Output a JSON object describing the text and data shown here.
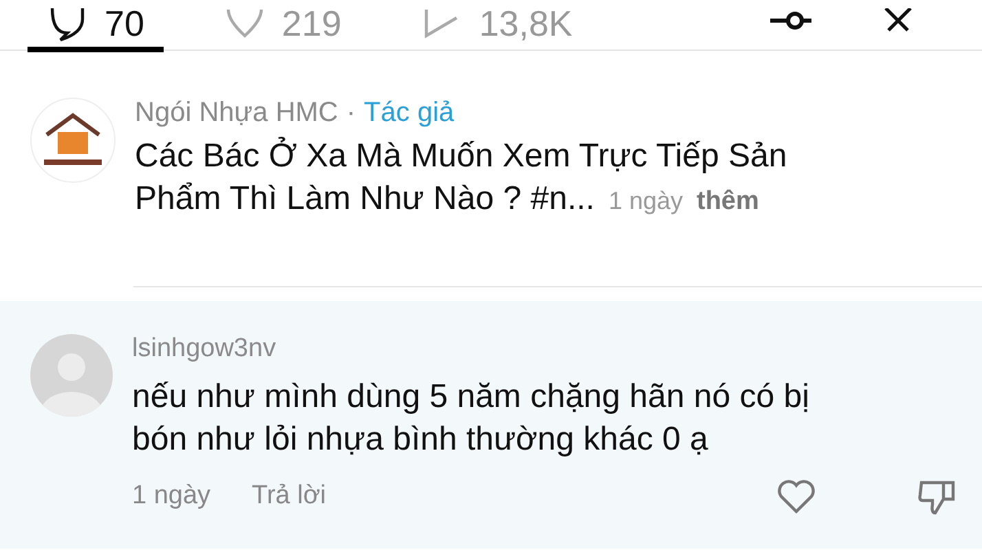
{
  "tabs": [
    {
      "kind": "comments",
      "label": "70",
      "selected": true
    },
    {
      "kind": "likes",
      "label": "219",
      "selected": false
    },
    {
      "kind": "shares",
      "label": "13,8K",
      "selected": false
    }
  ],
  "post": {
    "author": "Ngói Nhựa HMC",
    "separator": "·",
    "badge": "Tác giả",
    "caption": "Các Bác Ở Xa Mà Muốn Xem Trực Tiếp Sản Phẩm Thì Làm Như Nào ? #n...",
    "time": "1 ngày",
    "more": "thêm"
  },
  "comment": {
    "user": "lsinhgow3nv",
    "text": "nếu như mình dùng 5 năm chặng hãn nó có bị bón như lỏi nhựa bình thường khác 0 ạ",
    "time": "1 ngày",
    "reply": "Trả lời",
    "liked": false
  }
}
